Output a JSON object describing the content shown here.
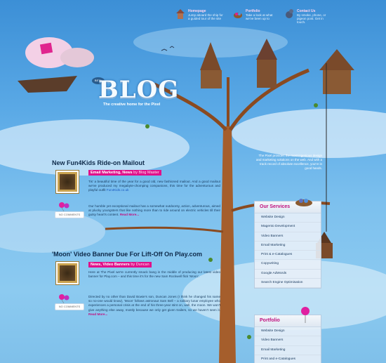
{
  "nav": [
    {
      "title": "Homepage",
      "desc": "Jump aboard the ship for a guided tour of the site"
    },
    {
      "title": "Portfolio",
      "desc": "Take a look at what we've been up to"
    },
    {
      "title": "Contact Us",
      "desc": "By smoke, phone, or pigeon post. Get in touch."
    }
  ],
  "blog": {
    "title": "BLOG",
    "beta": "BETA",
    "tagline": "The creative home for the Pixel"
  },
  "posts": [
    {
      "title": "New Fun4Kids Ride-on Mailout",
      "categories": "Email Marketing, News",
      "by": "by Blog Master",
      "comments": "NO COMMENTS",
      "p1": "Tis' a beautiful time of the year for a good old, new fashioned mailout. And a good mailout we've produced my megabyte-chomping companions, this time for the adventurous and playful outfit",
      "p1_link": "Fun4Kids.co.uk",
      "p2": "Our humble yet exceptional mailout has a somewhat outdoorsy, action, adventurous, aimed at plucky youngsters that like nothing more than to ride around on electric vehicles till their gutsy heart's content.",
      "more": "Read More..."
    },
    {
      "title": "'Moon' Video Banner Due For Lift-Off On Play.com",
      "categories": "News, Video Banners",
      "by": "by Duncan",
      "comments": "NO COMMENTS",
      "p1": "Here at The Pixel we're currently smack bang in the middle of producing our latest video banner for Play.com – and this time it's for the new Sam Rockwell flick 'Moon'.",
      "p2": "Directed by no other than David Bowie's son, Duncan Jones (I think he changed his name so no-one would know), 'Moon' follows astronaut Sam Bell – a solitary lunar employee who experiences a personal crisis at the end of his three-year stint on, well, the moon. We won't give anything else away, mostly because we only get given trailers, so we haven't seen it.",
      "more": "Read More..."
    }
  ],
  "about": "The Pixel provides the most ingenious design and marketing solutions on the web. And with a track record of absolute excellence, you're in good hands.",
  "services": {
    "title": "Our Services",
    "items": [
      "Website Design",
      "Magento Development",
      "Video Banners",
      "Email Marketing",
      "Print & e-Catalogues",
      "Copywriting",
      "Google AdWords",
      "Search Engine Optimisation"
    ]
  },
  "portfolio": {
    "title": "Portfolio",
    "items": [
      "Website Design",
      "Video Banners",
      "Email Marketing",
      "Print and e-Catalogues"
    ]
  }
}
